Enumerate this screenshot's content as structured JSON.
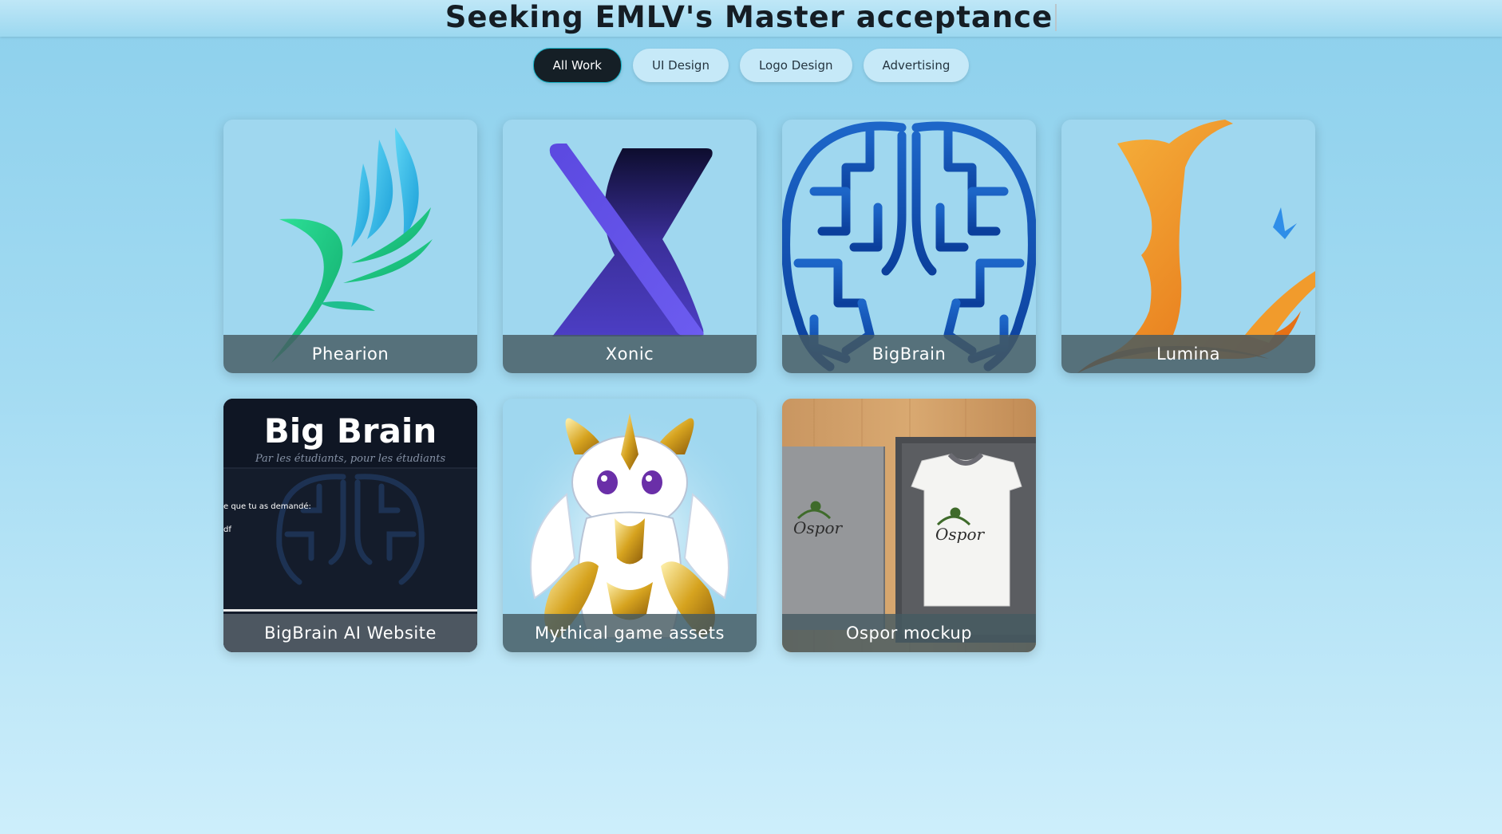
{
  "header": {
    "title": "Seeking EMLV's Master acceptance"
  },
  "filters": [
    {
      "label": "All Work",
      "active": true
    },
    {
      "label": "UI Design",
      "active": false
    },
    {
      "label": "Logo Design",
      "active": false
    },
    {
      "label": "Advertising",
      "active": false
    }
  ],
  "cards": [
    {
      "caption": "Phearion"
    },
    {
      "caption": "Xonic"
    },
    {
      "caption": "BigBrain"
    },
    {
      "caption": "Lumina"
    },
    {
      "caption": "BigBrain AI Website",
      "preview": {
        "heading": "Big Brain",
        "tagline": "Par les étudiants, pour les étudiants",
        "line1": "e que tu as demandé:",
        "line2": "df"
      }
    },
    {
      "caption": "Mythical game assets"
    },
    {
      "caption": "Ospor mockup",
      "brand": "Ospor"
    }
  ],
  "colors": {
    "accent_dark": "#151f26",
    "filter_bg": "#c6e9f8",
    "caption_overlay": "#465a62"
  }
}
